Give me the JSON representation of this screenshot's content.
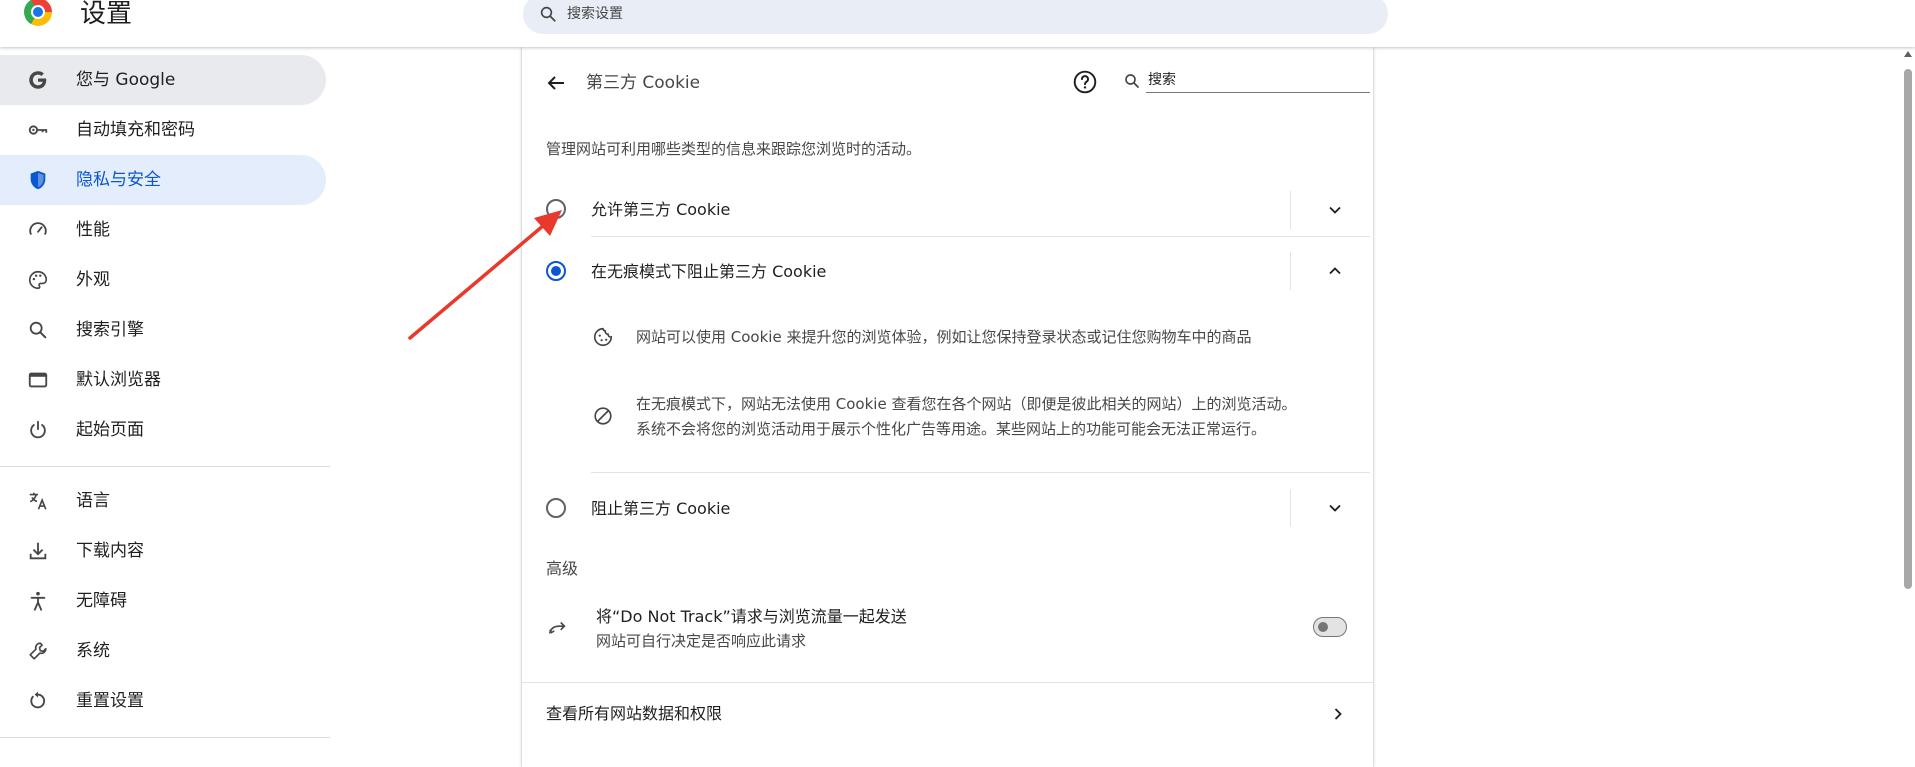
{
  "header": {
    "app_title": "设置",
    "search_placeholder": "搜索设置"
  },
  "sidebar": {
    "items": [
      {
        "label": "您与 Google",
        "icon": "google-g-icon"
      },
      {
        "label": "自动填充和密码",
        "icon": "key-icon"
      },
      {
        "label": "隐私与安全",
        "icon": "shield-icon"
      },
      {
        "label": "性能",
        "icon": "speedometer-icon"
      },
      {
        "label": "外观",
        "icon": "palette-icon"
      },
      {
        "label": "搜索引擎",
        "icon": "search-icon"
      },
      {
        "label": "默认浏览器",
        "icon": "browser-window-icon"
      },
      {
        "label": "起始页面",
        "icon": "power-icon"
      },
      {
        "label": "语言",
        "icon": "translate-icon"
      },
      {
        "label": "下载内容",
        "icon": "download-icon"
      },
      {
        "label": "无障碍",
        "icon": "accessibility-icon"
      },
      {
        "label": "系统",
        "icon": "wrench-icon"
      },
      {
        "label": "重置设置",
        "icon": "reset-icon"
      }
    ]
  },
  "main": {
    "title": "第三方 Cookie",
    "search_placeholder": "搜索",
    "description": "管理网站可利用哪些类型的信息来跟踪您浏览时的活动。",
    "options": [
      {
        "label": "允许第三方 Cookie",
        "checked": false,
        "expanded": false
      },
      {
        "label": "在无痕模式下阻止第三方 Cookie",
        "checked": true,
        "expanded": true
      },
      {
        "label": "阻止第三方 Cookie",
        "checked": false,
        "expanded": false
      }
    ],
    "incognito_details": [
      {
        "icon": "cookie-icon",
        "lines": [
          "网站可以使用 Cookie 来提升您的浏览体验，例如让您保持登录状态或记住您购物车中的商品"
        ]
      },
      {
        "icon": "block-icon",
        "lines": [
          "在无痕模式下，网站无法使用 Cookie 查看您在各个网站（即便是彼此相关的网站）上的浏览活动。",
          "系统不会将您的浏览活动用于展示个性化广告等用途。某些网站上的功能可能会无法正常运行。"
        ]
      }
    ],
    "advanced_title": "高级",
    "dnt": {
      "title": "将“Do Not Track”请求与浏览流量一起发送",
      "subtitle": "网站可自行决定是否响应此请求",
      "enabled": false
    },
    "site_data_link": "查看所有网站数据和权限"
  },
  "colors": {
    "accent": "#0b57d0",
    "active_nav_bg": "#e4edfc",
    "annotation_arrow": "#e8392c"
  }
}
